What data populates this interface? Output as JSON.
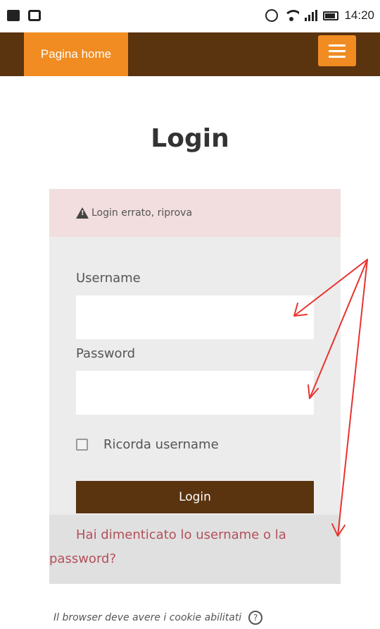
{
  "status_bar": {
    "time": "14:20"
  },
  "navbar": {
    "home_label": "Pagina home",
    "menu_icon": "hamburger-icon"
  },
  "page": {
    "title": "Login"
  },
  "login_form": {
    "alert_text": "Login errato, riprova",
    "username_label": "Username",
    "username_value": "",
    "password_label": "Password",
    "password_value": "",
    "remember_label": "Ricorda username",
    "submit_label": "Login",
    "forgot_link": "Hai dimenticato lo username o la password?"
  },
  "footer": {
    "cookies_notice": "Il browser deve avere i cookie abilitati"
  },
  "colors": {
    "brand_dark": "#5a330f",
    "brand_orange": "#f08c22",
    "alert_bg": "#f2dede",
    "link": "#b3505a",
    "annotation": "#e8332f"
  }
}
